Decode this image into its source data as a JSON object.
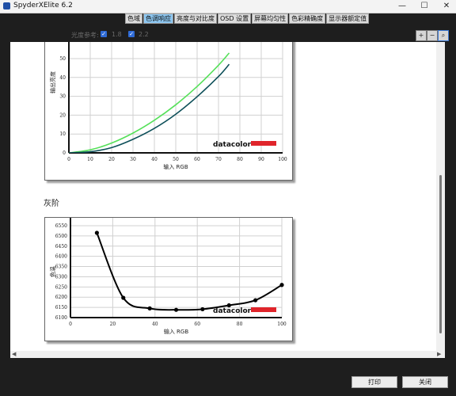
{
  "window": {
    "title": "SpyderXElite 6.2",
    "controls": [
      "—",
      "☐",
      "✕"
    ]
  },
  "tabs": [
    {
      "label": "色域",
      "active": false
    },
    {
      "label": "色调响应",
      "active": true
    },
    {
      "label": "亮度与对比度",
      "active": false
    },
    {
      "label": "OSD 设置",
      "active": false
    },
    {
      "label": "屏幕均匀性",
      "active": false
    },
    {
      "label": "色彩精确度",
      "active": false
    },
    {
      "label": "显示器额定值",
      "active": false
    }
  ],
  "toolbar": {
    "gamma_label": "光度参考:",
    "options": [
      {
        "value": "1.8",
        "checked": true
      },
      {
        "value": "2.2",
        "checked": true
      }
    ],
    "zoom_buttons": [
      "zoom-in-icon",
      "zoom-out-icon",
      "zoom-fit-icon"
    ]
  },
  "sections": {
    "grayscale_title": "灰阶"
  },
  "brand": {
    "logo": "datacolor",
    "accent": "#e0252b"
  },
  "chart_data": [
    {
      "type": "line",
      "title": "",
      "xlabel": "输入 RGB",
      "ylabel": "输出亮度",
      "xlim": [
        0,
        100
      ],
      "ylim_visible": [
        0,
        50
      ],
      "x_ticks": [
        0,
        10,
        20,
        30,
        40,
        50,
        60,
        70,
        80,
        90,
        100
      ],
      "y_ticks": [
        0,
        10,
        20,
        30,
        40,
        50
      ],
      "series": [
        {
          "color": "#56e05a",
          "x": [
            0,
            10,
            20,
            30,
            40,
            50,
            60,
            70,
            75
          ],
          "y": [
            0,
            1.6,
            5.2,
            10.5,
            17.3,
            25.5,
            35.2,
            46.5,
            53
          ]
        },
        {
          "color": "#0d4f59",
          "x": [
            0,
            10,
            20,
            30,
            40,
            50,
            60,
            70,
            75
          ],
          "y": [
            0,
            0.6,
            2.8,
            7.2,
            13.0,
            20.5,
            29.8,
            40.5,
            47
          ]
        }
      ]
    },
    {
      "type": "line",
      "title": "",
      "xlabel": "输入 RGB",
      "ylabel": "色温",
      "xlim": [
        0,
        100
      ],
      "ylim": [
        6100,
        6550
      ],
      "x_ticks": [
        0,
        20,
        40,
        60,
        80,
        100
      ],
      "y_ticks": [
        6100,
        6150,
        6200,
        6250,
        6300,
        6350,
        6400,
        6450,
        6500,
        6550
      ],
      "series": [
        {
          "color": "#000000",
          "x": [
            12.5,
            25,
            37.5,
            50,
            62.5,
            75,
            87.5,
            100
          ],
          "y": [
            6515,
            6197,
            6145,
            6138,
            6141,
            6160,
            6185,
            6260
          ]
        }
      ]
    }
  ],
  "footer": {
    "print_label": "打印",
    "close_label": "关闭"
  }
}
